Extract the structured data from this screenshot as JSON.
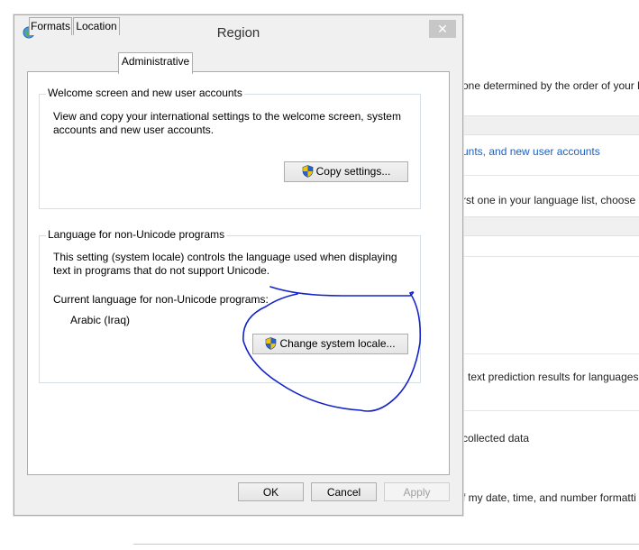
{
  "background": {
    "lines": [
      "one determined by the order of your l",
      "unts, and new user accounts",
      "rst one in your language list, choose it",
      "l text prediction results for languages",
      "collected data",
      "f my date, time, and number formatti"
    ]
  },
  "dialog": {
    "title": "Region",
    "close_glyph": "✕",
    "tabs": [
      {
        "label": "Formats"
      },
      {
        "label": "Location"
      },
      {
        "label": "Administrative"
      }
    ],
    "welcome": {
      "title": "Welcome screen and new user accounts",
      "desc_line1": "View and copy your international settings to the welcome screen, system",
      "desc_line2": "accounts and new user accounts.",
      "button": "Copy settings..."
    },
    "nonunicode": {
      "title": "Language for non-Unicode programs",
      "desc_line1": "This setting (system locale) controls the language used when displaying",
      "desc_line2": "text in programs that do not support Unicode.",
      "current_label": "Current language for non-Unicode programs:",
      "current_value": "Arabic (Iraq)",
      "button": "Change system locale..."
    },
    "buttons": {
      "ok": "OK",
      "cancel": "Cancel",
      "apply": "Apply"
    }
  },
  "colors": {
    "annotation": "#1424c8",
    "link": "#1f5fbf"
  },
  "icons": {
    "title": "globe-icon",
    "shield": "uac-shield-icon"
  }
}
